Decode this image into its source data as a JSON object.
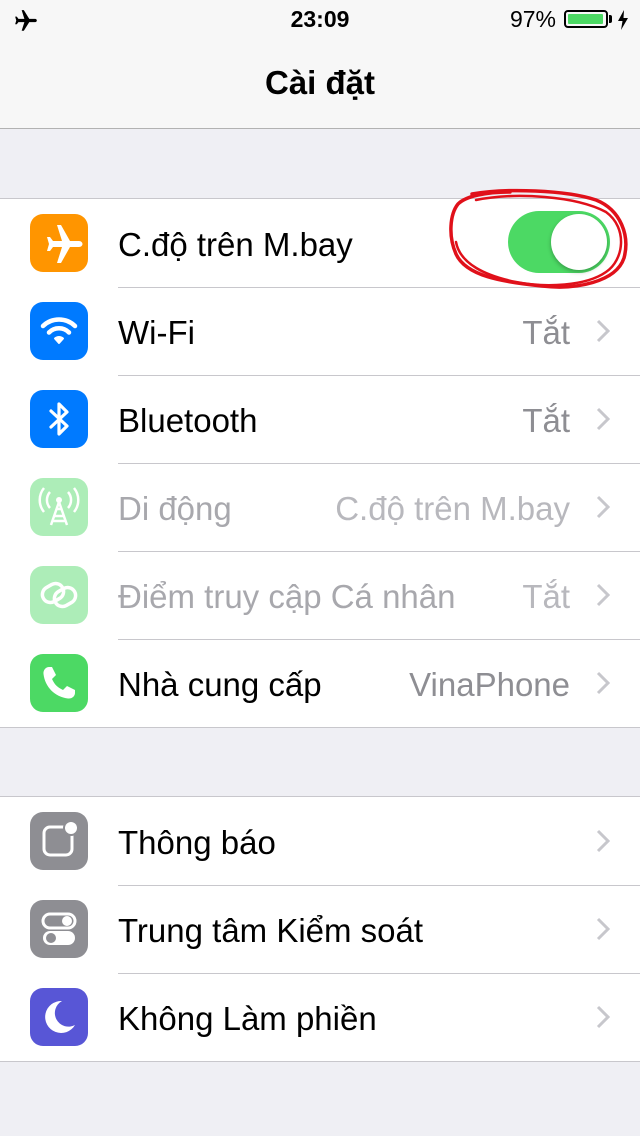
{
  "status_bar": {
    "time": "23:09",
    "battery_percent": "97%",
    "battery_level": 0.97,
    "left_icon": "airplane-icon",
    "charging_icon": "bolt-icon"
  },
  "nav": {
    "title": "Cài đặt"
  },
  "colors": {
    "toggle_on": "#4cd964",
    "airplane_icon_bg": "#ff9500",
    "wifi_icon_bg": "#007aff",
    "bluetooth_icon_bg": "#007aff",
    "cellular_icon_bg": "#4cd964",
    "hotspot_icon_bg": "#4cd964",
    "carrier_icon_bg": "#4cd964",
    "notifications_icon_bg": "#8e8e93",
    "control_center_icon_bg": "#8e8e93",
    "dnd_icon_bg": "#5856d6",
    "annotation": "#e0101a"
  },
  "group1": {
    "rows": [
      {
        "label": "C.độ trên M.bay",
        "icon": "airplane-icon",
        "toggle_on": true
      },
      {
        "label": "Wi-Fi",
        "value": "Tắt",
        "icon": "wifi-icon"
      },
      {
        "label": "Bluetooth",
        "value": "Tắt",
        "icon": "bluetooth-icon"
      },
      {
        "label": "Di động",
        "value": "C.độ trên M.bay",
        "icon": "cellular-antenna-icon",
        "disabled": true
      },
      {
        "label": "Điểm truy cập Cá nhân",
        "value": "Tắt",
        "icon": "link-icon",
        "disabled": true
      },
      {
        "label": "Nhà cung cấp",
        "value": "VinaPhone",
        "icon": "phone-icon"
      }
    ]
  },
  "group2": {
    "rows": [
      {
        "label": "Thông báo",
        "icon": "notifications-icon"
      },
      {
        "label": "Trung tâm Kiểm soát",
        "icon": "control-center-icon"
      },
      {
        "label": "Không Làm phiền",
        "icon": "moon-icon"
      }
    ]
  }
}
